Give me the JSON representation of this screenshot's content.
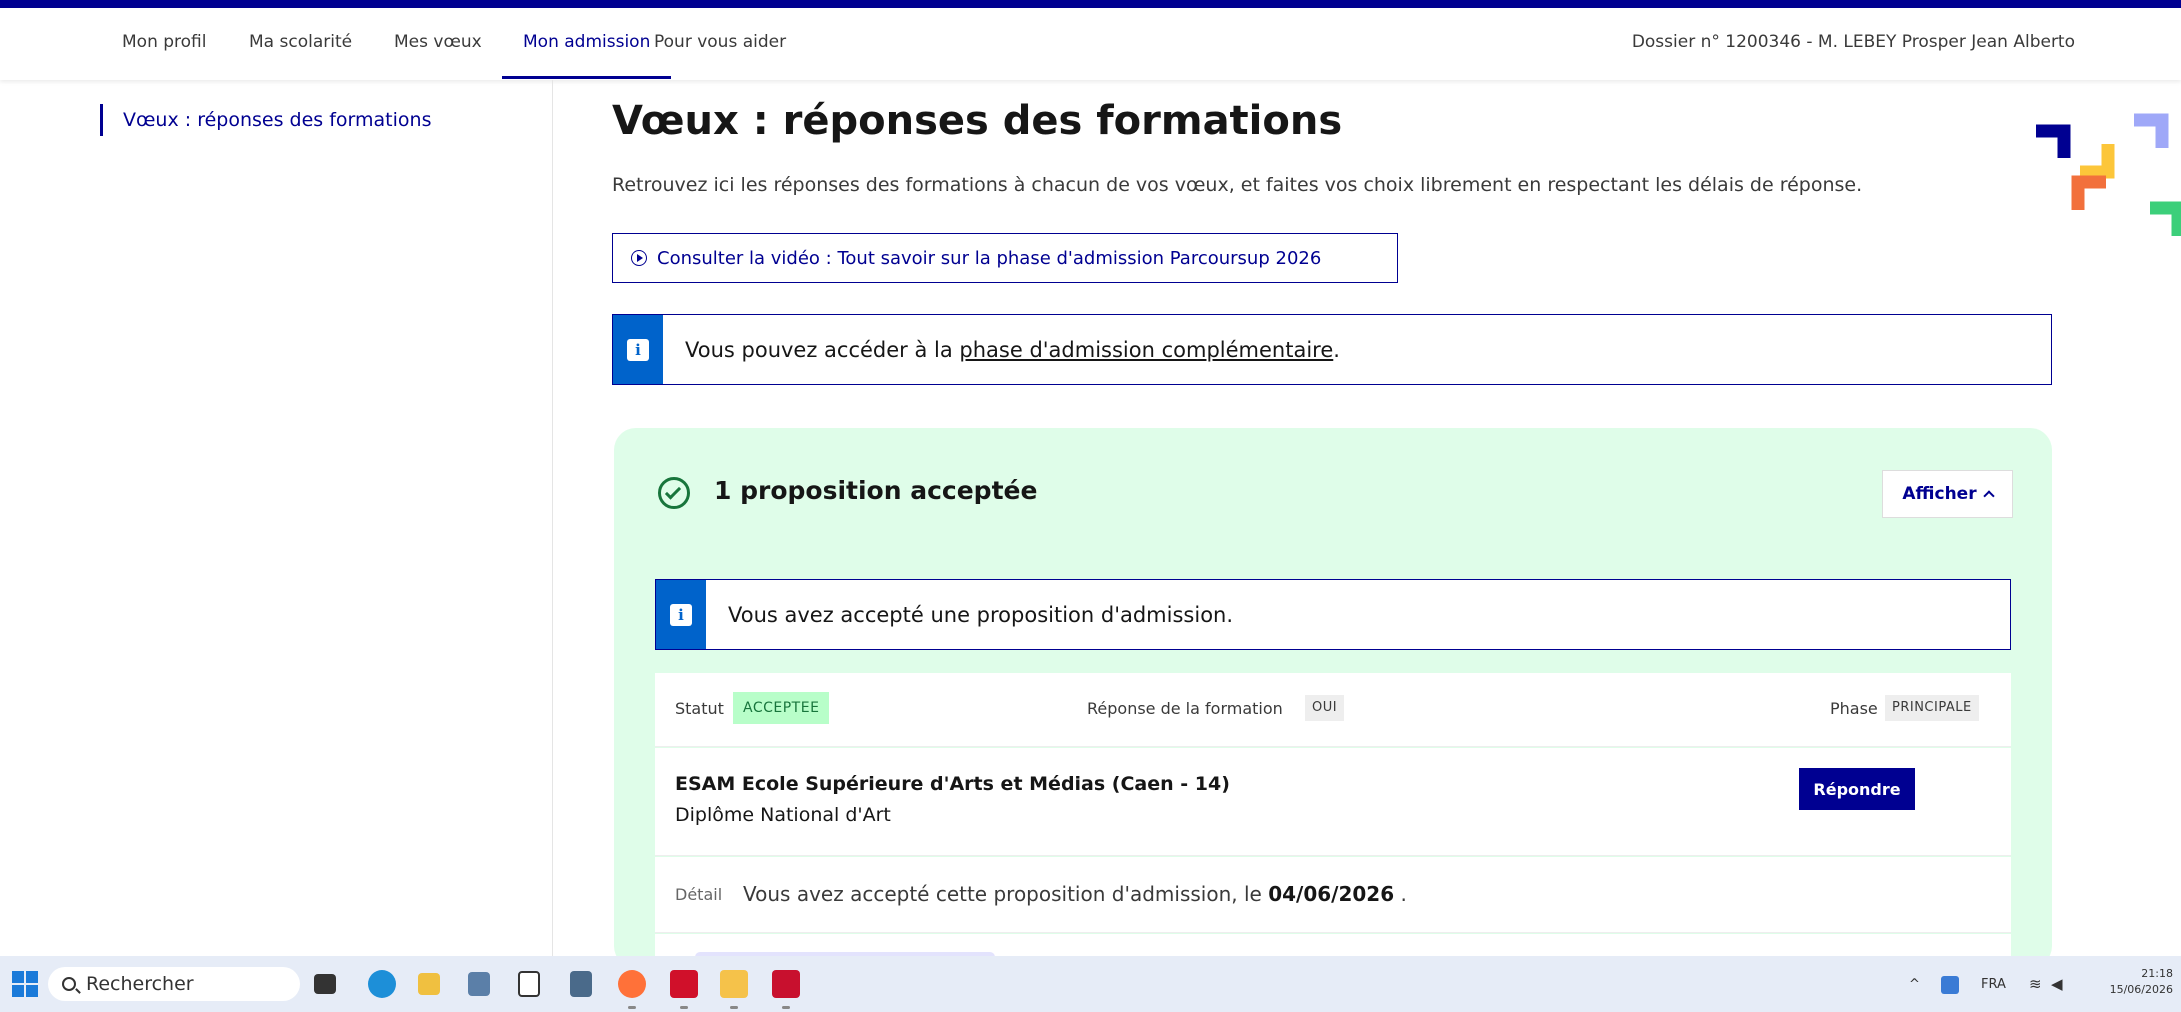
{
  "topnav": {
    "items": [
      {
        "label": "Mon profil"
      },
      {
        "label": "Ma scolarité"
      },
      {
        "label": "Mes vœux"
      },
      {
        "label": "Mon admission"
      },
      {
        "label": "Pour vous aider"
      }
    ],
    "active_item": "Mon admission",
    "dossier": "Dossier n° 1200346 - M. LEBEY Prosper Jean Alberto"
  },
  "sidebar": {
    "link": "Vœux : réponses des formations"
  },
  "main": {
    "title": "Vœux : réponses des formations",
    "subtitle": "Retrouvez ici les réponses des formations à chacun de vos vœux, et faites vos choix librement en respectant les délais de réponse.",
    "video_button": "Consulter la vidéo : Tout savoir sur la phase d'admission Parcoursup 2026",
    "notice_prefix": "Vous pouvez accéder à la ",
    "notice_link": "phase d'admission complémentaire",
    "notice_suffix": "."
  },
  "card": {
    "title": "1 proposition acceptée",
    "toggle_label": "Afficher",
    "notice": "Vous avez accepté une proposition d'admission.",
    "status_label": "Statut",
    "status_value": "ACCEPTEE",
    "response_label": "Réponse de la formation",
    "response_value": "OUI",
    "phase_label": "Phase",
    "phase_value": "PRINCIPALE",
    "formation_name": "ESAM Ecole Supérieure d'Arts et Médias (Caen - 14)",
    "formation_diploma": "Diplôme National d'Art",
    "respond_button": "Répondre",
    "detail_label": "Détail",
    "detail_text": "Vous avez accepté cette proposition d'admission, le ",
    "detail_date": "04/06/2026",
    "detail_end": " ."
  },
  "taskbar": {
    "search_placeholder": "Rechercher",
    "lang": "FRA",
    "time": "21:18",
    "date": "15/06/2026"
  },
  "colors": {
    "brand_blue": "#000091",
    "info_blue": "#0063cb",
    "success_green": "#18753c",
    "card_bg": "#dffde9"
  }
}
